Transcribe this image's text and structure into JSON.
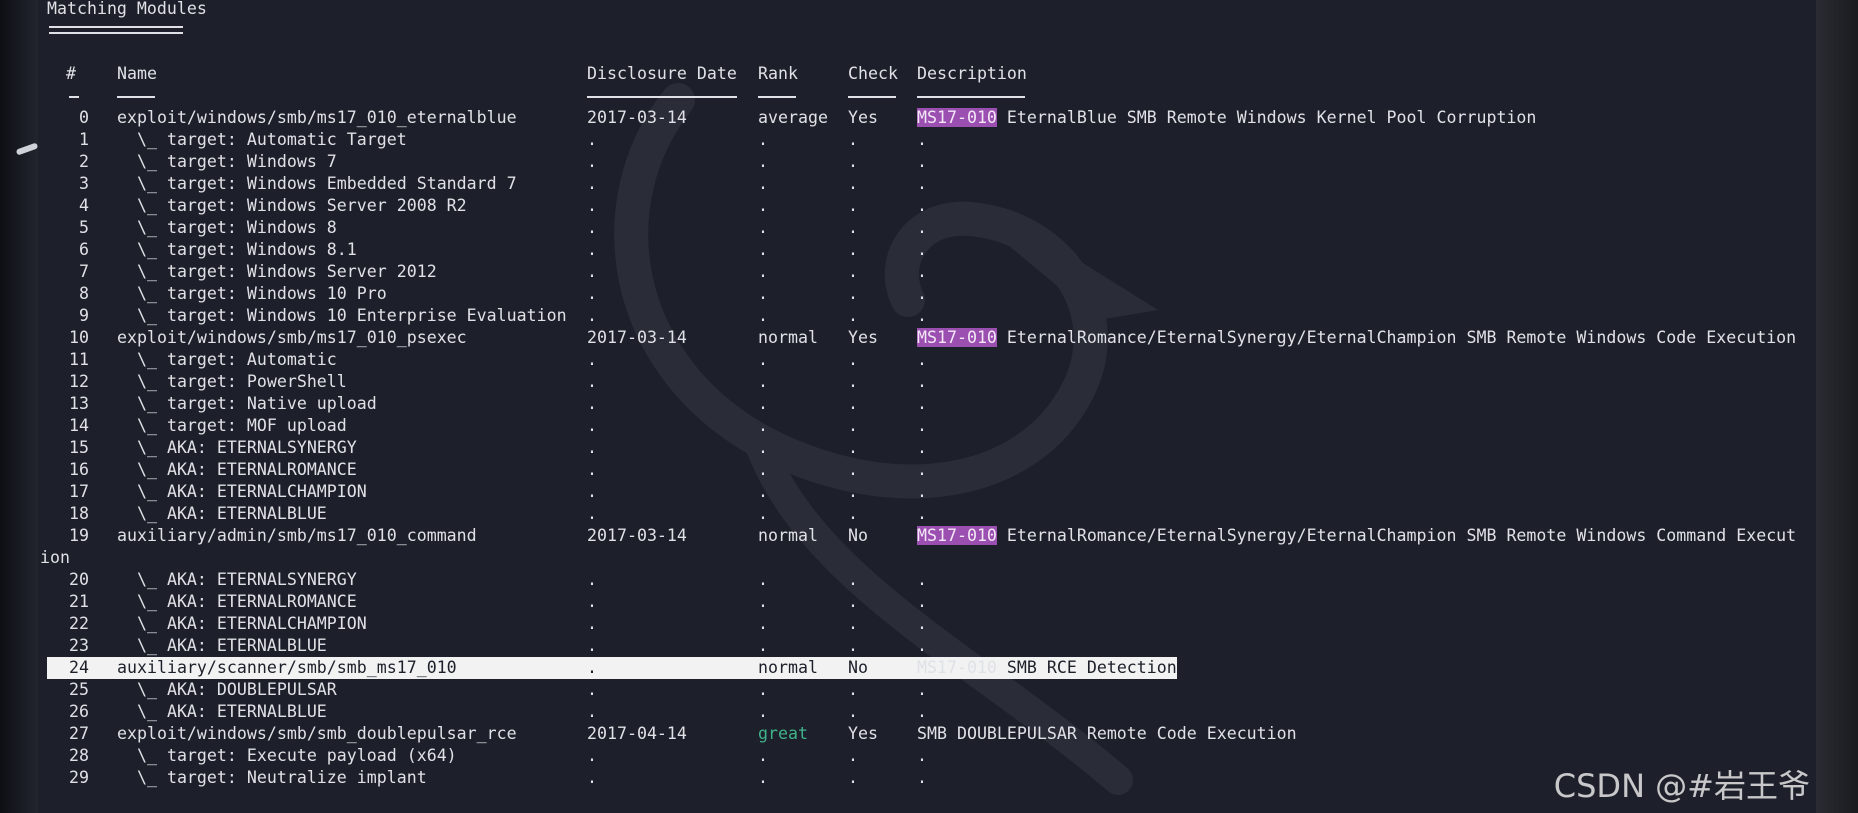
{
  "section_title": "Matching Modules",
  "headers": {
    "num": "#",
    "name": "Name",
    "date": "Disclosure Date",
    "rank": "Rank",
    "check": "Check",
    "desc": "Description"
  },
  "rows": [
    {
      "num": "0",
      "name": "exploit/windows/smb/ms17_010_eternalblue",
      "date": "2017-03-14",
      "rank": "average",
      "check": "Yes",
      "tag": "MS17-010",
      "desc": " EternalBlue SMB Remote Windows Kernel Pool Corruption"
    },
    {
      "num": "1",
      "name": "  \\_ target: Automatic Target",
      "date": ".",
      "rank": ".",
      "check": ".",
      "tag": "",
      "desc": "."
    },
    {
      "num": "2",
      "name": "  \\_ target: Windows 7",
      "date": ".",
      "rank": ".",
      "check": ".",
      "tag": "",
      "desc": "."
    },
    {
      "num": "3",
      "name": "  \\_ target: Windows Embedded Standard 7",
      "date": ".",
      "rank": ".",
      "check": ".",
      "tag": "",
      "desc": "."
    },
    {
      "num": "4",
      "name": "  \\_ target: Windows Server 2008 R2",
      "date": ".",
      "rank": ".",
      "check": ".",
      "tag": "",
      "desc": "."
    },
    {
      "num": "5",
      "name": "  \\_ target: Windows 8",
      "date": ".",
      "rank": ".",
      "check": ".",
      "tag": "",
      "desc": "."
    },
    {
      "num": "6",
      "name": "  \\_ target: Windows 8.1",
      "date": ".",
      "rank": ".",
      "check": ".",
      "tag": "",
      "desc": "."
    },
    {
      "num": "7",
      "name": "  \\_ target: Windows Server 2012",
      "date": ".",
      "rank": ".",
      "check": ".",
      "tag": "",
      "desc": "."
    },
    {
      "num": "8",
      "name": "  \\_ target: Windows 10 Pro",
      "date": ".",
      "rank": ".",
      "check": ".",
      "tag": "",
      "desc": "."
    },
    {
      "num": "9",
      "name": "  \\_ target: Windows 10 Enterprise Evaluation",
      "date": ".",
      "rank": ".",
      "check": ".",
      "tag": "",
      "desc": "."
    },
    {
      "num": "10",
      "name": "exploit/windows/smb/ms17_010_psexec",
      "date": "2017-03-14",
      "rank": "normal",
      "check": "Yes",
      "tag": "MS17-010",
      "desc": " EternalRomance/EternalSynergy/EternalChampion SMB Remote Windows Code Execution"
    },
    {
      "num": "11",
      "name": "  \\_ target: Automatic",
      "date": ".",
      "rank": ".",
      "check": ".",
      "tag": "",
      "desc": "."
    },
    {
      "num": "12",
      "name": "  \\_ target: PowerShell",
      "date": ".",
      "rank": ".",
      "check": ".",
      "tag": "",
      "desc": "."
    },
    {
      "num": "13",
      "name": "  \\_ target: Native upload",
      "date": ".",
      "rank": ".",
      "check": ".",
      "tag": "",
      "desc": "."
    },
    {
      "num": "14",
      "name": "  \\_ target: MOF upload",
      "date": ".",
      "rank": ".",
      "check": ".",
      "tag": "",
      "desc": "."
    },
    {
      "num": "15",
      "name": "  \\_ AKA: ETERNALSYNERGY",
      "date": ".",
      "rank": ".",
      "check": ".",
      "tag": "",
      "desc": "."
    },
    {
      "num": "16",
      "name": "  \\_ AKA: ETERNALROMANCE",
      "date": ".",
      "rank": ".",
      "check": ".",
      "tag": "",
      "desc": "."
    },
    {
      "num": "17",
      "name": "  \\_ AKA: ETERNALCHAMPION",
      "date": ".",
      "rank": ".",
      "check": ".",
      "tag": "",
      "desc": "."
    },
    {
      "num": "18",
      "name": "  \\_ AKA: ETERNALBLUE",
      "date": ".",
      "rank": ".",
      "check": ".",
      "tag": "",
      "desc": "."
    },
    {
      "num": "19",
      "name": "auxiliary/admin/smb/ms17_010_command",
      "date": "2017-03-14",
      "rank": "normal",
      "check": "No",
      "tag": "MS17-010",
      "desc": " EternalRomance/EternalSynergy/EternalChampion SMB Remote Windows Command Execut"
    },
    {
      "num": "20",
      "name": "  \\_ AKA: ETERNALSYNERGY",
      "date": ".",
      "rank": ".",
      "check": ".",
      "tag": "",
      "desc": "."
    },
    {
      "num": "21",
      "name": "  \\_ AKA: ETERNALROMANCE",
      "date": ".",
      "rank": ".",
      "check": ".",
      "tag": "",
      "desc": "."
    },
    {
      "num": "22",
      "name": "  \\_ AKA: ETERNALCHAMPION",
      "date": ".",
      "rank": ".",
      "check": ".",
      "tag": "",
      "desc": "."
    },
    {
      "num": "23",
      "name": "  \\_ AKA: ETERNALBLUE",
      "date": ".",
      "rank": ".",
      "check": ".",
      "tag": "",
      "desc": "."
    },
    {
      "num": "24",
      "name": "auxiliary/scanner/smb/smb_ms17_010",
      "date": ".",
      "rank": "normal",
      "check": "No",
      "tag": "MS17-010",
      "desc": " SMB RCE Detection"
    },
    {
      "num": "25",
      "name": "  \\_ AKA: DOUBLEPULSAR",
      "date": ".",
      "rank": ".",
      "check": ".",
      "tag": "",
      "desc": "."
    },
    {
      "num": "26",
      "name": "  \\_ AKA: ETERNALBLUE",
      "date": ".",
      "rank": ".",
      "check": ".",
      "tag": "",
      "desc": "."
    },
    {
      "num": "27",
      "name": "exploit/windows/smb/smb_doublepulsar_rce",
      "date": "2017-04-14",
      "rank": "great",
      "check": "Yes",
      "tag": "",
      "desc": "SMB DOUBLEPULSAR Remote Code Execution"
    },
    {
      "num": "28",
      "name": "  \\_ target: Execute payload (x64)",
      "date": ".",
      "rank": ".",
      "check": ".",
      "tag": "",
      "desc": "."
    },
    {
      "num": "29",
      "name": "  \\_ target: Neutralize implant",
      "date": ".",
      "rank": ".",
      "check": ".",
      "tag": "",
      "desc": "."
    }
  ],
  "wrap_text_row19": "ion",
  "highlighted_row_index": 24,
  "colors": {
    "background": "#1d202a",
    "text": "#dfe1e6",
    "tag_bg": "#9b4fb0",
    "rank_great": "#3fb28a",
    "highlight_bg": "#f2f2f2"
  },
  "watermark": "CSDN @#岩王爷"
}
